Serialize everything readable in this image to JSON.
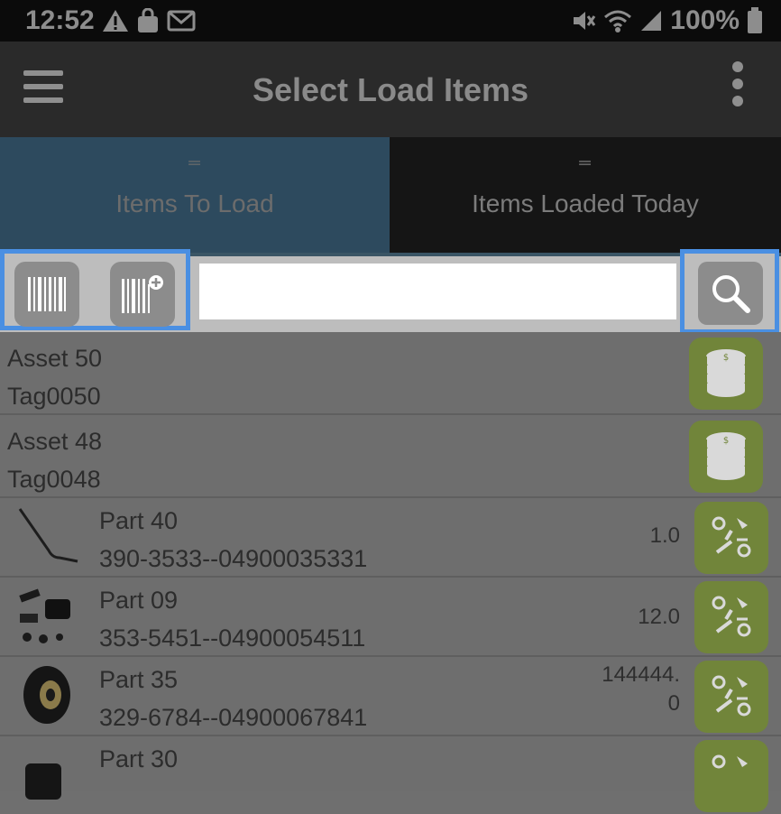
{
  "status_bar": {
    "time": "12:52",
    "left_icons": [
      "warning-icon",
      "shopping-bag-icon",
      "gmail-icon"
    ],
    "right_icons": [
      "mute-icon",
      "wifi-icon",
      "signal-icon"
    ],
    "battery": "100%"
  },
  "app_bar": {
    "title": "Select Load Items",
    "menu_icon": "hamburger-menu-icon",
    "overflow_icon": "more-vert-icon"
  },
  "tabs": [
    {
      "label": "Items To Load",
      "active": true
    },
    {
      "label": "Items Loaded Today",
      "active": false
    }
  ],
  "search": {
    "value": "",
    "placeholder": "",
    "scan_icon": "barcode-icon",
    "scan_add_icon": "barcode-add-icon",
    "search_icon": "magnifier-icon"
  },
  "items": [
    {
      "kind": "asset",
      "name": "Asset 50",
      "tag": "Tag0050",
      "icon": "coin-stack-icon"
    },
    {
      "kind": "asset",
      "name": "Asset 48",
      "tag": "Tag0048",
      "icon": "coin-stack-icon"
    },
    {
      "kind": "part",
      "name": "Part 40",
      "number": "390-3533--04900035331",
      "qty": "1.0",
      "icon": "tools-icon",
      "thumb": "bent-rod-thumbnail"
    },
    {
      "kind": "part",
      "name": "Part 09",
      "number": "353-5451--04900054511",
      "qty": "12.0",
      "icon": "tools-icon",
      "thumb": "small-parts-thumbnail"
    },
    {
      "kind": "part",
      "name": "Part 35",
      "number": "329-6784--04900067841",
      "qty_line1": "144444.",
      "qty_line2": "0",
      "icon": "tools-icon",
      "thumb": "wheel-thumbnail"
    },
    {
      "kind": "part",
      "name": "Part 30",
      "number": "",
      "qty": "",
      "icon": "tools-icon",
      "thumb": "part-thumbnail"
    }
  ],
  "colors": {
    "highlight": "#4a8fe2",
    "active_tab": "#2d4a5e",
    "asset_button": "#71853a",
    "part_button": "#71853a"
  }
}
